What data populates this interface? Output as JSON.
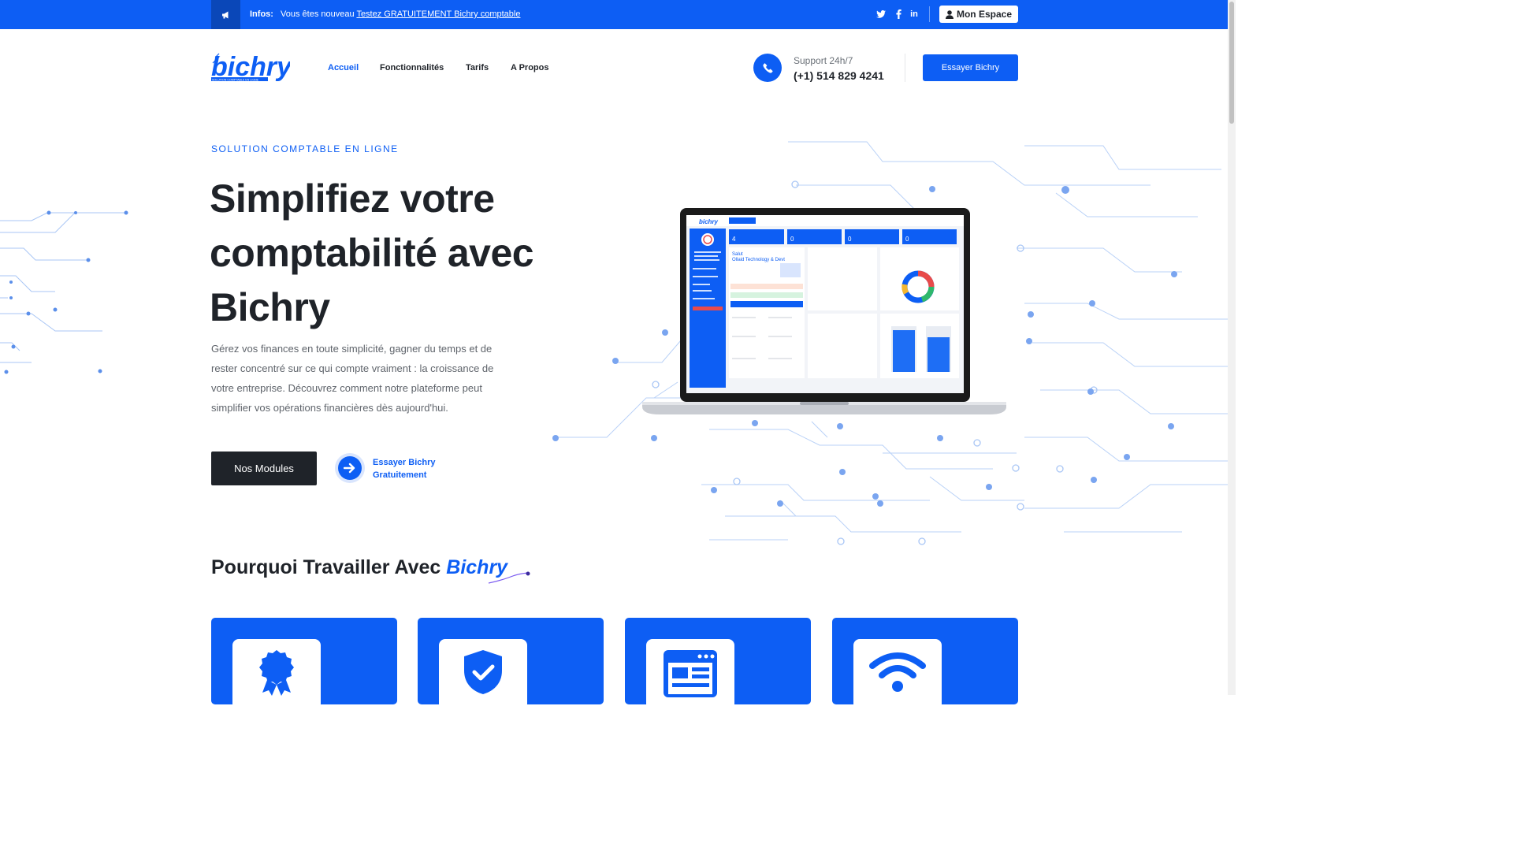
{
  "topbar": {
    "info_label": "Infos:",
    "info_text": "Vous êtes nouveau ",
    "info_link": "Testez GRATUITEMENT Bichry comptable",
    "espace_label": "Mon Espace",
    "social": [
      "twitter-icon",
      "facebook-icon",
      "linkedin-icon"
    ]
  },
  "header": {
    "logo_text": "bichry",
    "logo_tagline": "SOLUTION COMPTABLE EN LIGNE",
    "nav": [
      "Accueil",
      "Fonctionnalités",
      "Tarifs",
      "A Propos"
    ],
    "active_nav": "Accueil",
    "support_label": "Support 24h/7",
    "support_phone": "(+1) 514 829 4241",
    "cta_label": "Essayer Bichry"
  },
  "hero": {
    "eyebrow": "SOLUTION COMPTABLE EN LIGNE",
    "title": "Simplifiez votre comptabilité avec Bichry",
    "description": "Gérez vos finances en toute simplicité, gagner du temps et de rester concentré sur ce qui compte vraiment : la croissance de votre entreprise. Découvrez comment notre plateforme peut simplifier vos opérations financières dès aujourd'hui.",
    "primary_button": "Nos Modules",
    "secondary_link_line1": "Essayer Bichry",
    "secondary_link_line2": "Gratuitement"
  },
  "why": {
    "title_prefix": "Pourquoi Travailler Avec ",
    "title_brand": "Bichry",
    "cards": [
      {
        "icon": "award-badge-icon"
      },
      {
        "icon": "shield-check-icon"
      },
      {
        "icon": "browser-news-icon"
      },
      {
        "icon": "wifi-icon"
      }
    ]
  },
  "colors": {
    "primary": "#0d5ef4",
    "dark": "#1f2329",
    "text_muted": "#5f646b"
  }
}
